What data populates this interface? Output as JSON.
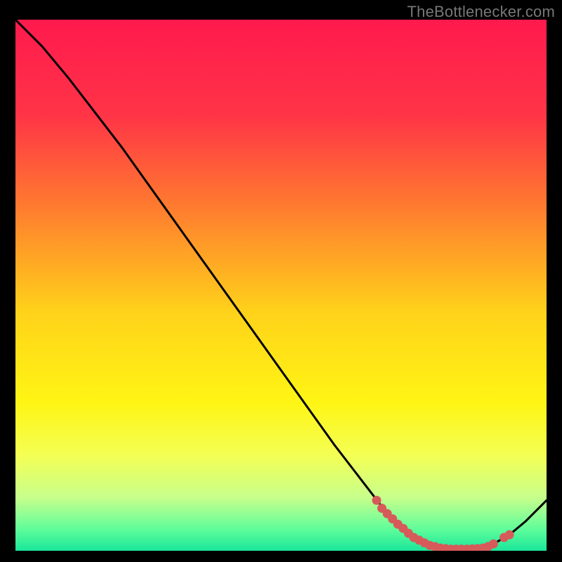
{
  "watermark": "TheBottlenecker.com",
  "chart_data": {
    "type": "line",
    "title": "",
    "xlabel": "",
    "ylabel": "",
    "xlim": [
      0,
      100
    ],
    "ylim": [
      0,
      100
    ],
    "x": [
      0,
      5,
      10,
      15,
      20,
      25,
      30,
      35,
      40,
      45,
      50,
      55,
      60,
      65,
      70,
      72,
      75,
      78,
      80,
      82,
      85,
      88,
      90,
      93,
      96,
      100
    ],
    "values": [
      100,
      95,
      89,
      82.5,
      76,
      69,
      62,
      55,
      48,
      41,
      34,
      27,
      20,
      13.5,
      7,
      5,
      2.5,
      1,
      0.5,
      0.3,
      0.3,
      0.5,
      1.3,
      3,
      5.5,
      9.5
    ],
    "markers_x": [
      68,
      69,
      70,
      71,
      72,
      73,
      74,
      75,
      76,
      77,
      78,
      79,
      80,
      81,
      82,
      83,
      84,
      85,
      86,
      87,
      88,
      89,
      90,
      92,
      93
    ],
    "markers_y": [
      9.5,
      8,
      7,
      6,
      5,
      4.2,
      3.3,
      2.5,
      2,
      1.5,
      1,
      0.8,
      0.5,
      0.4,
      0.3,
      0.3,
      0.3,
      0.3,
      0.35,
      0.4,
      0.5,
      0.8,
      1.3,
      2.5,
      3
    ],
    "gradient_stops": [
      {
        "offset": 0.0,
        "color": "#ff1a4d"
      },
      {
        "offset": 0.18,
        "color": "#ff3447"
      },
      {
        "offset": 0.35,
        "color": "#ff7a2f"
      },
      {
        "offset": 0.55,
        "color": "#ffd21a"
      },
      {
        "offset": 0.72,
        "color": "#fff514"
      },
      {
        "offset": 0.82,
        "color": "#f4ff54"
      },
      {
        "offset": 0.9,
        "color": "#c7ff8c"
      },
      {
        "offset": 0.96,
        "color": "#5efd9a"
      },
      {
        "offset": 1.0,
        "color": "#1ae69a"
      }
    ],
    "marker_color": "#d75a5a",
    "line_color": "#000000"
  }
}
